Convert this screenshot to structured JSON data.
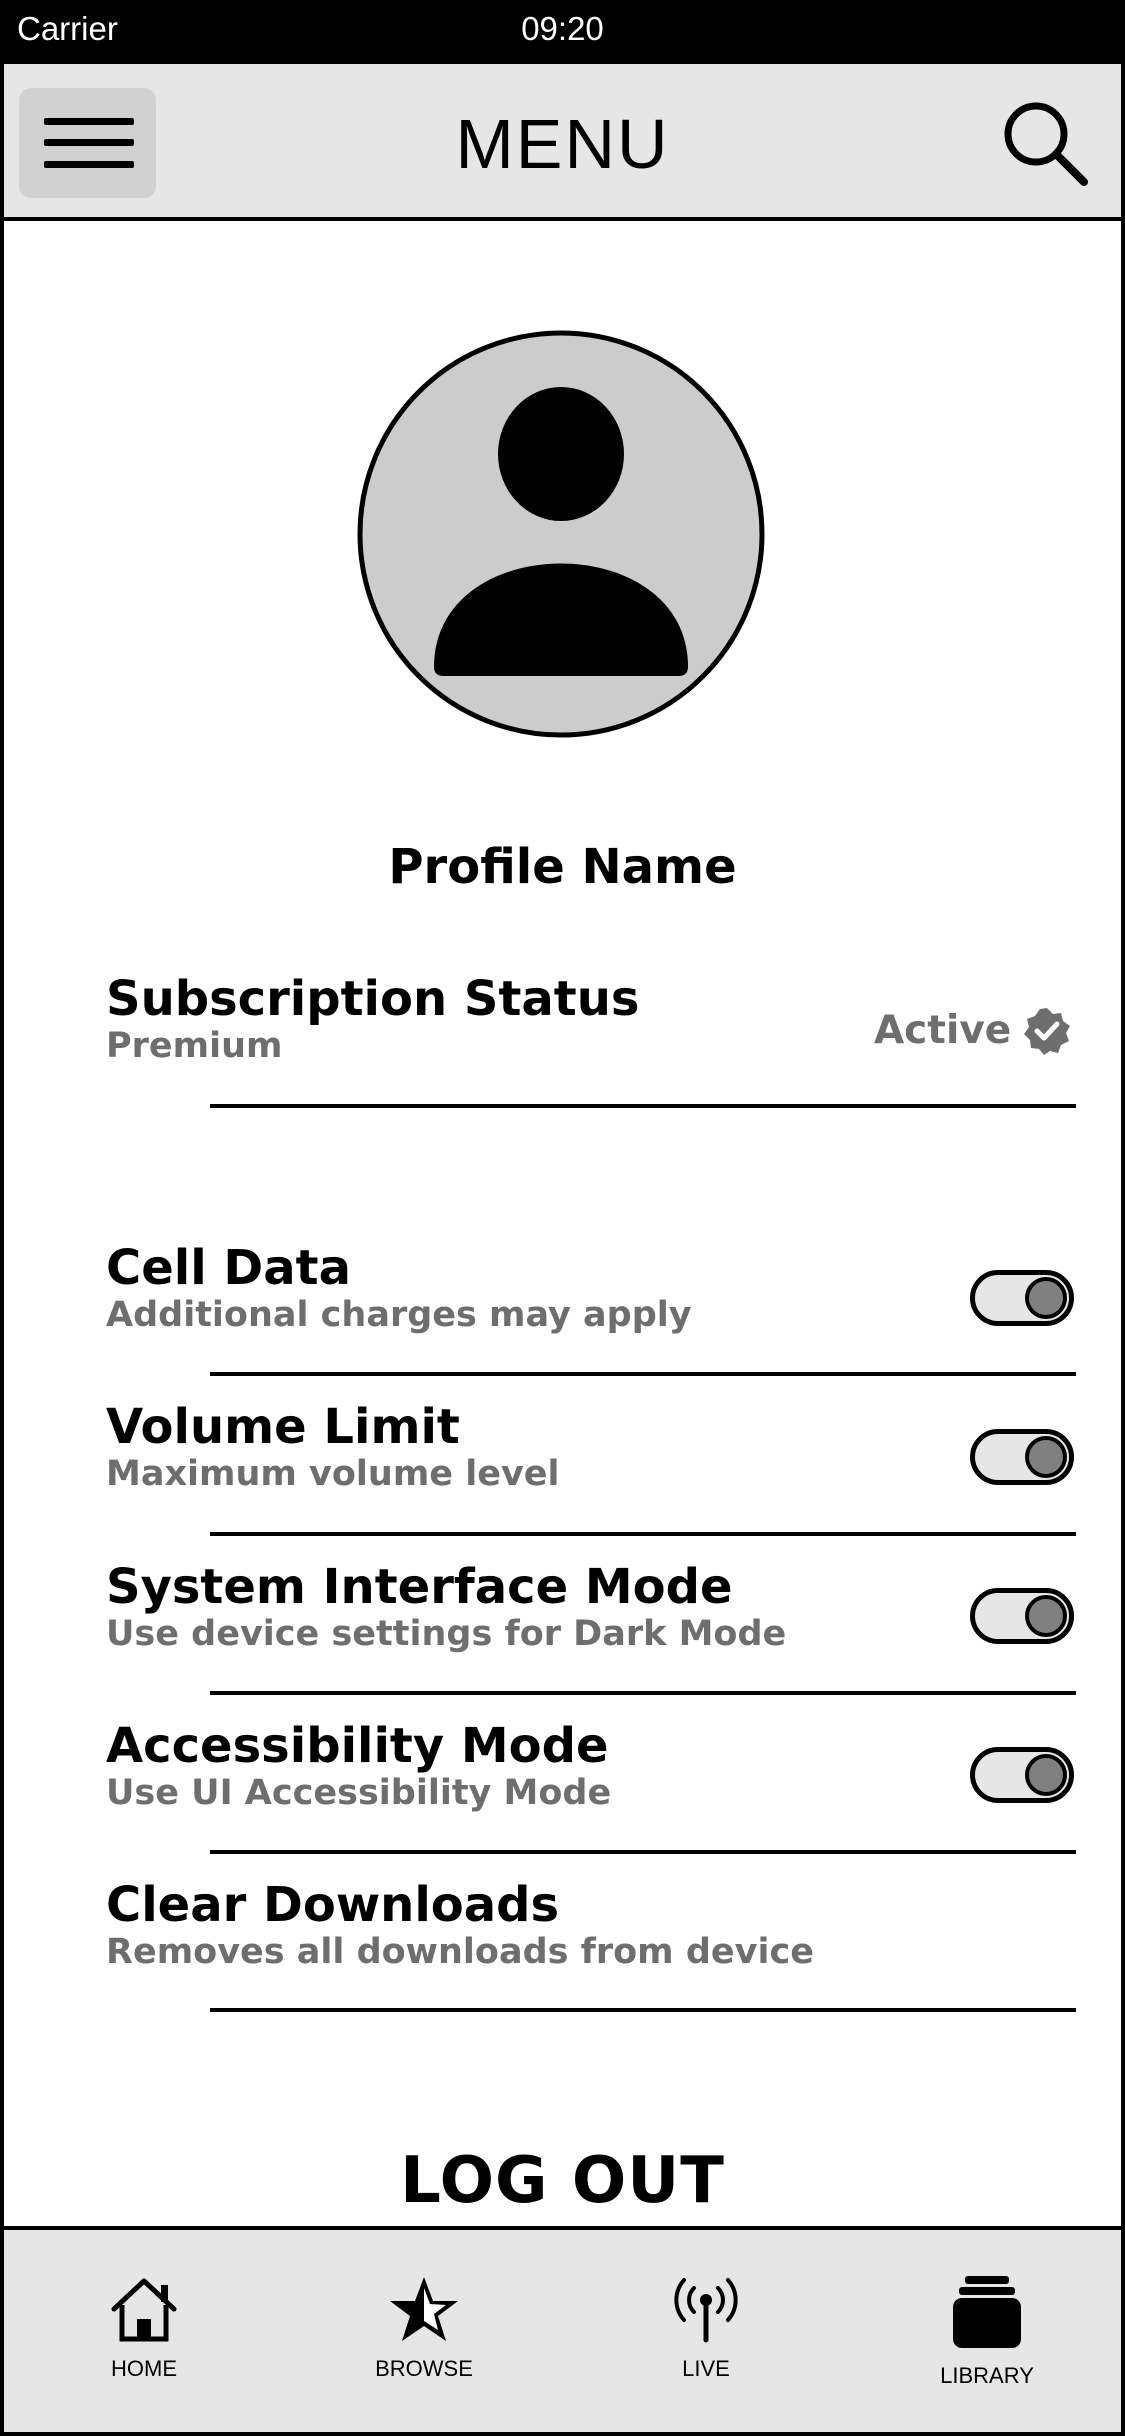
{
  "status_bar": {
    "carrier": "Carrier",
    "time": "09:20"
  },
  "header": {
    "title": "MENU",
    "menu_icon": "hamburger-icon",
    "search_icon": "search-icon"
  },
  "profile": {
    "name": "Profile Name",
    "avatar_icon": "user-avatar-icon"
  },
  "subscription": {
    "title": "Subscription Status",
    "subtitle": "Premium",
    "value": "Active",
    "badge_icon": "verified-badge-icon"
  },
  "settings": [
    {
      "title": "Cell Data",
      "subtitle": "Additional charges may apply",
      "toggle": true
    },
    {
      "title": "Volume Limit",
      "subtitle": "Maximum volume level",
      "toggle": true
    },
    {
      "title": "System Interface Mode",
      "subtitle": "Use device settings for Dark Mode",
      "toggle": true
    },
    {
      "title": "Accessibility Mode",
      "subtitle": "Use UI Accessibility Mode",
      "toggle": true
    },
    {
      "title": "Clear Downloads",
      "subtitle": "Removes all downloads from device"
    }
  ],
  "logout_label": "LOG OUT",
  "tabbar": [
    {
      "label": "HOME",
      "icon": "home-icon"
    },
    {
      "label": "BROWSE",
      "icon": "star-icon"
    },
    {
      "label": "LIVE",
      "icon": "broadcast-icon"
    },
    {
      "label": "LIBRARY",
      "icon": "library-icon"
    }
  ],
  "colors": {
    "header_bg": "#e6e6e6",
    "secondary_text": "#6e6e6e",
    "toggle_knob": "#808080"
  }
}
